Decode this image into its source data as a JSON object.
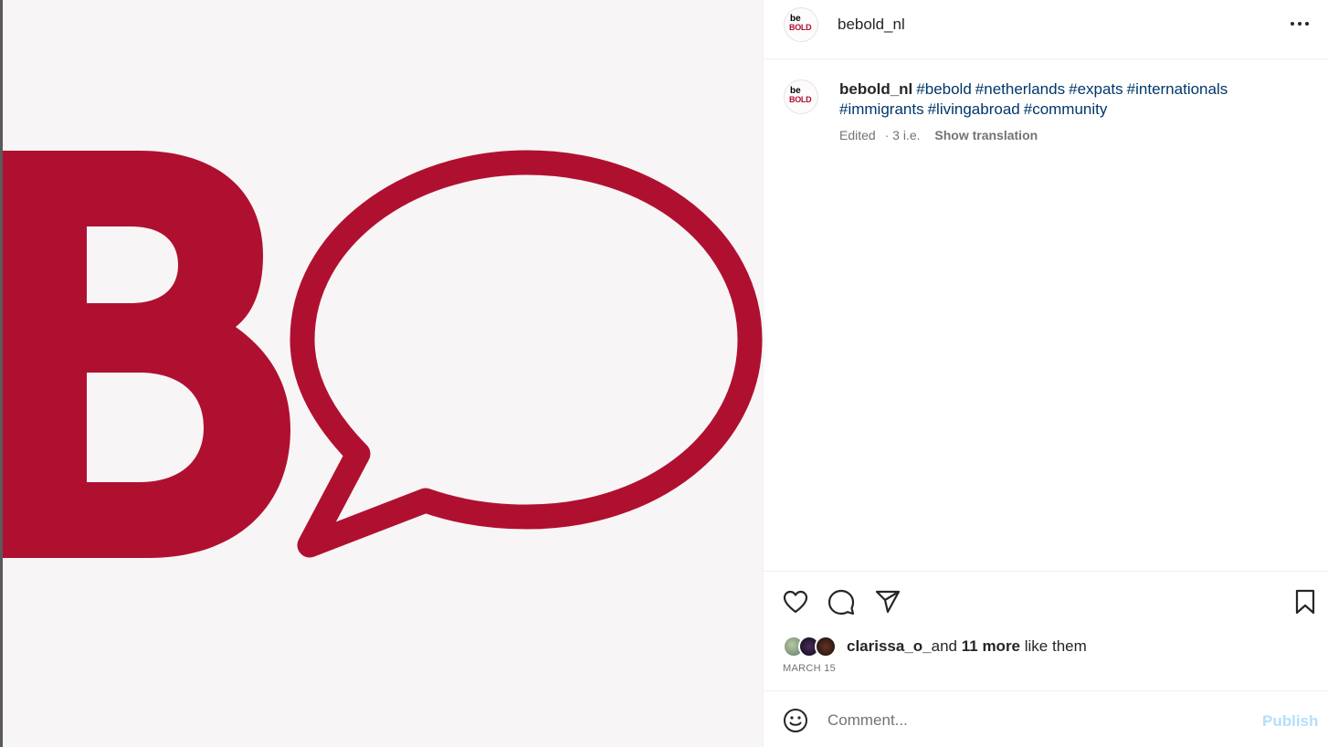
{
  "post": {
    "username": "bebold_nl",
    "avatar_logo": {
      "line1": "be",
      "line2": "BOLD"
    },
    "brand_color": "#B01030",
    "media": {
      "description_icon": "b-speech-bubble-logo"
    }
  },
  "caption": {
    "username": "bebold_nl",
    "hashtags": [
      "#bebold",
      "#netherlands",
      "#expats",
      "#internationals",
      "#immigrants",
      "#livingabroad",
      "#community"
    ],
    "edited_label": "Edited",
    "time": "· 3 i.e.",
    "translate_label": "Show translation"
  },
  "actions": {
    "like_icon": "heart-icon",
    "comment_icon": "comment-icon",
    "share_icon": "paper-plane-icon",
    "save_icon": "bookmark-icon"
  },
  "likes": {
    "user": "clarissa_o_",
    "and": "and",
    "count": "11 more",
    "suffix": "like them"
  },
  "date": "MARCH 15",
  "comment": {
    "placeholder": "Comment...",
    "publish_label": "Publish",
    "emoji_icon": "smiley-icon"
  }
}
